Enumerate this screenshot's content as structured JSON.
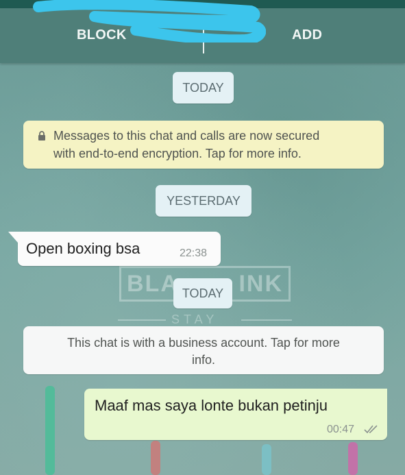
{
  "header": {
    "block_label": "BLOCK",
    "add_label": "ADD"
  },
  "chat": {
    "date_today_1": "TODAY",
    "encryption_notice_line1": "Messages to this chat and calls are now secured",
    "encryption_notice_line2": "with end-to-end encryption. Tap for more info.",
    "date_yesterday": "YESTERDAY",
    "incoming_message": {
      "text": "Open boxing bsa",
      "time": "22:38"
    },
    "date_today_2": "TODAY",
    "business_notice_line1": "This chat is with a business account. Tap for more",
    "business_notice_line2": "info.",
    "outgoing_message": {
      "text": "Maaf mas saya lonte bukan petinju",
      "time": "00:47"
    }
  },
  "wallpaper": {
    "watermark_left": "BLA",
    "watermark_right": "INK",
    "watermark_sub": "STAY"
  },
  "colors": {
    "header_bg": "#4f7f79",
    "chat_bg": "#6f9e9a",
    "outgoing_bubble": "#e8f8cf",
    "incoming_bubble": "#fbfbfb",
    "encryption_notice_bg": "#f5f3c4"
  },
  "icons": {
    "lock": "lock-icon",
    "read_receipt": "double-check-icon"
  }
}
